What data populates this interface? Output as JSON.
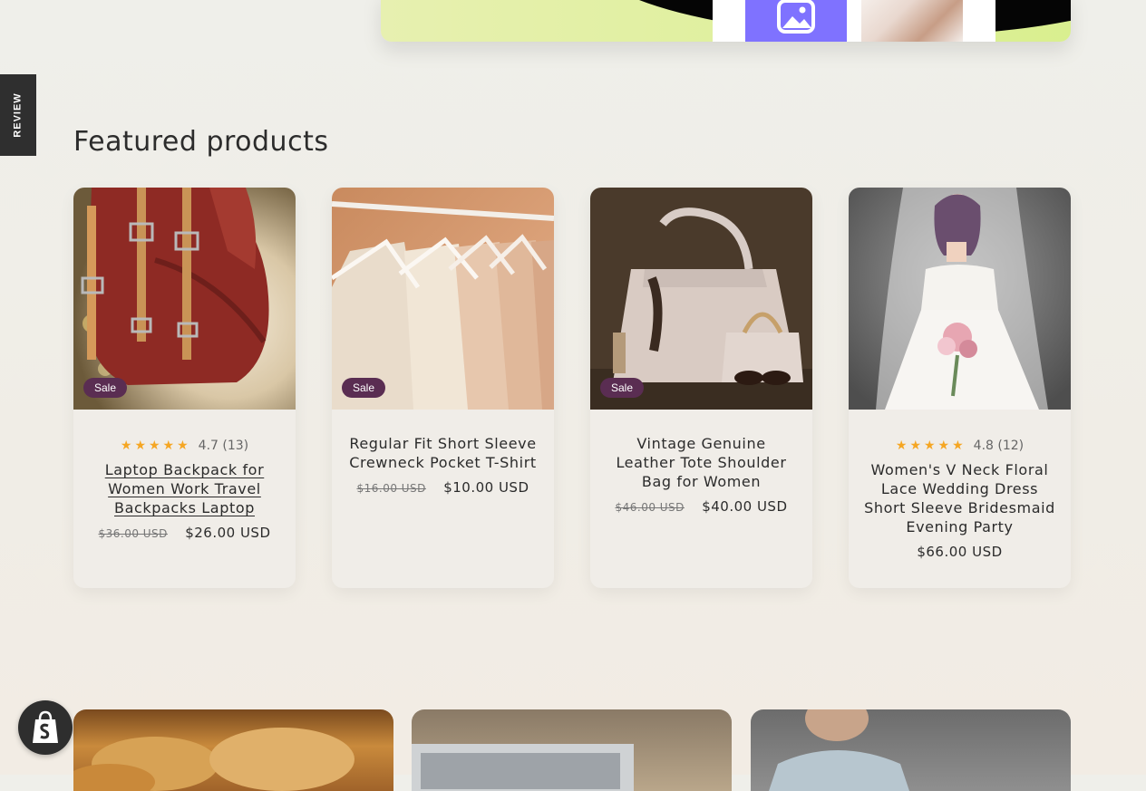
{
  "review_tab": {
    "label": "REVIEW"
  },
  "featured": {
    "title": "Featured products",
    "products": [
      {
        "title": "Laptop Backpack for Women Work Travel Backpacks Laptop",
        "badge": "Sale",
        "stars": "★★★★★",
        "rating_text": "4.7 (13)",
        "rating": 4.7,
        "review_count": 13,
        "old_price": "$36.00 USD",
        "price": "$26.00 USD"
      },
      {
        "title": "Regular Fit Short Sleeve Crewneck Pocket T-Shirt",
        "badge": "Sale",
        "old_price": "$16.00 USD",
        "price": "$10.00 USD"
      },
      {
        "title": "Vintage Genuine Leather Tote Shoulder Bag for Women",
        "badge": "Sale",
        "old_price": "$46.00 USD",
        "price": "$40.00 USD"
      },
      {
        "title": "Women's V Neck Floral Lace Wedding Dress Short Sleeve Bridesmaid Evening Party",
        "stars": "★★★★★",
        "rating_text": "4.8 (12)",
        "rating": 4.8,
        "review_count": 12,
        "price": "$66.00 USD"
      }
    ]
  },
  "colors": {
    "sale_badge": "#5a2d52",
    "star": "#f5a623",
    "banner_green": "#d9ef8f",
    "banner_purple": "#7f72ff"
  },
  "icons": {
    "banner_image": "image-icon",
    "store": "shopify-icon"
  }
}
